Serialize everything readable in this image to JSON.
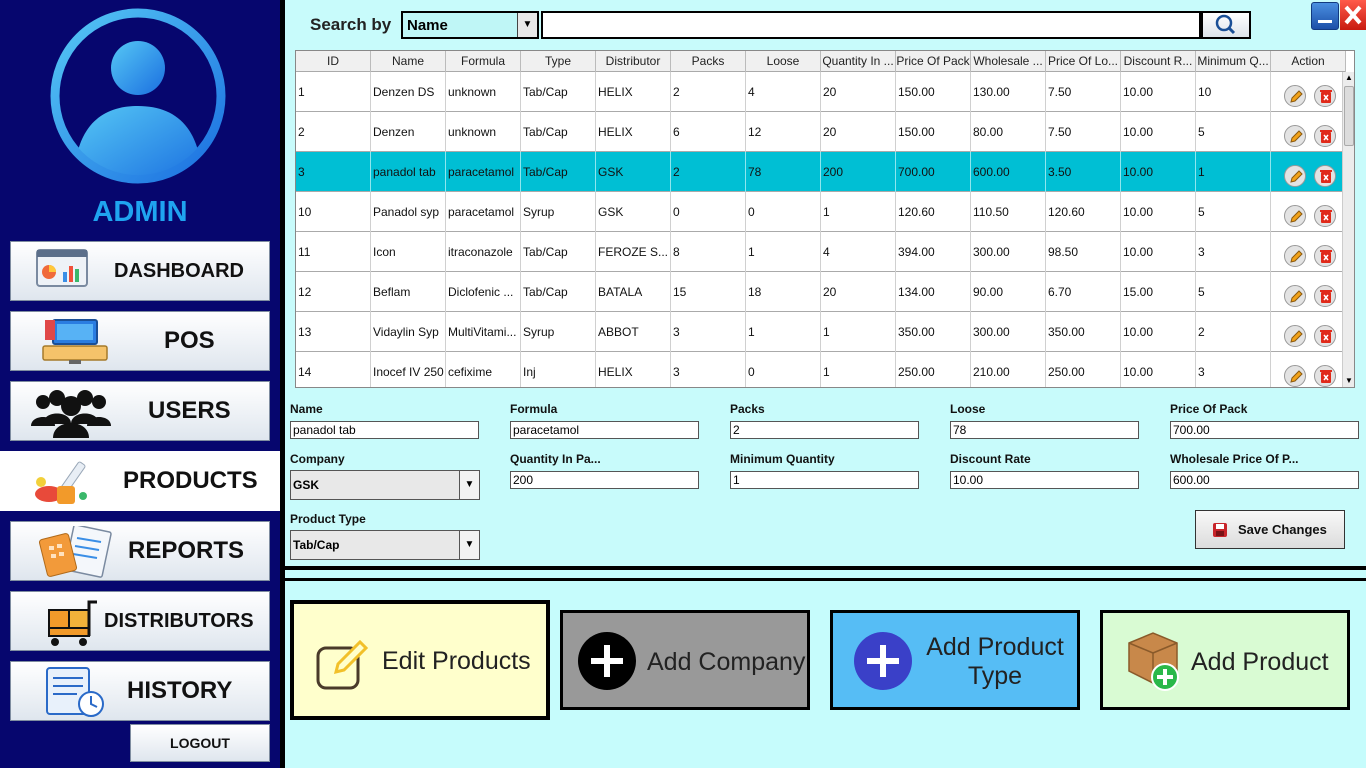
{
  "colors": {
    "sidebar": "#06066e",
    "accent": "#1fa4f0",
    "main_bg": "#c8fbfb",
    "selected_row": "#00bfd4"
  },
  "sidebar": {
    "user_role": "ADMIN",
    "items": [
      {
        "label": "DASHBOARD",
        "icon": "dashboard-icon"
      },
      {
        "label": "POS",
        "icon": "pos-terminal-icon"
      },
      {
        "label": "USERS",
        "icon": "users-group-icon"
      },
      {
        "label": "PRODUCTS",
        "icon": "medicine-icon",
        "active": true
      },
      {
        "label": "REPORTS",
        "icon": "reports-icon"
      },
      {
        "label": "DISTRIBUTORS",
        "icon": "distributor-cart-icon"
      },
      {
        "label": "HISTORY",
        "icon": "history-icon"
      }
    ],
    "logout_label": "LOGOUT"
  },
  "search": {
    "label": "Search by",
    "field": "Name",
    "value": ""
  },
  "table": {
    "columns": [
      "ID",
      "Name",
      "Formula",
      "Type",
      "Distributor",
      "Packs",
      "Loose",
      "Quantity In ...",
      "Price Of Pack",
      "Wholesale ...",
      "Price Of Lo...",
      "Discount R...",
      "Minimum Q...",
      "Action"
    ],
    "rows": [
      [
        "1",
        "Denzen DS",
        "unknown",
        "Tab/Cap",
        "HELIX",
        "2",
        "4",
        "20",
        "150.00",
        "130.00",
        "7.50",
        "10.00",
        "10"
      ],
      [
        "2",
        "Denzen",
        "unknown",
        "Tab/Cap",
        "HELIX",
        "6",
        "12",
        "20",
        "150.00",
        "80.00",
        "7.50",
        "10.00",
        "5"
      ],
      [
        "3",
        "panadol tab",
        "paracetamol",
        "Tab/Cap",
        "GSK",
        "2",
        "78",
        "200",
        "700.00",
        "600.00",
        "3.50",
        "10.00",
        "1"
      ],
      [
        "10",
        "Panadol syp",
        "paracetamol",
        "Syrup",
        "GSK",
        "0",
        "0",
        "1",
        "120.60",
        "110.50",
        "120.60",
        "10.00",
        "5"
      ],
      [
        "11",
        "Icon",
        "itraconazole",
        "Tab/Cap",
        "FEROZE S...",
        "8",
        "1",
        "4",
        "394.00",
        "300.00",
        "98.50",
        "10.00",
        "3"
      ],
      [
        "12",
        "Beflam",
        "Diclofenic ...",
        "Tab/Cap",
        "BATALA",
        "15",
        "18",
        "20",
        "134.00",
        "90.00",
        "6.70",
        "15.00",
        "5"
      ],
      [
        "13",
        "Vidaylin Syp",
        "MultiVitami...",
        "Syrup",
        "ABBOT",
        "3",
        "1",
        "1",
        "350.00",
        "300.00",
        "350.00",
        "10.00",
        "2"
      ],
      [
        "14",
        "Inocef IV 250",
        "cefixime",
        "Inj",
        "HELIX",
        "3",
        "0",
        "1",
        "250.00",
        "210.00",
        "250.00",
        "10.00",
        "3"
      ]
    ],
    "selected_index": 2
  },
  "form": {
    "name": {
      "label": "Name",
      "value": "panadol tab"
    },
    "formula": {
      "label": "Formula",
      "value": "paracetamol"
    },
    "packs": {
      "label": "Packs",
      "value": "2"
    },
    "loose": {
      "label": "Loose",
      "value": "78"
    },
    "price_of_pack": {
      "label": "Price Of Pack",
      "value": "700.00"
    },
    "company": {
      "label": "Company",
      "value": "GSK"
    },
    "quantity_in_pack": {
      "label": "Quantity In Pa...",
      "value": "200"
    },
    "minimum_quantity": {
      "label": "Minimum Quantity",
      "value": "1"
    },
    "discount_rate": {
      "label": "Discount Rate",
      "value": "10.00"
    },
    "wholesale_price": {
      "label": "Wholesale Price Of P...",
      "value": "600.00"
    },
    "product_type": {
      "label": "Product Type",
      "value": "Tab/Cap"
    },
    "save_label": "Save Changes"
  },
  "actions": {
    "edit_products": "Edit Products",
    "add_company": "Add Company",
    "add_product_type": "Add Product Type",
    "add_product": "Add Product"
  }
}
